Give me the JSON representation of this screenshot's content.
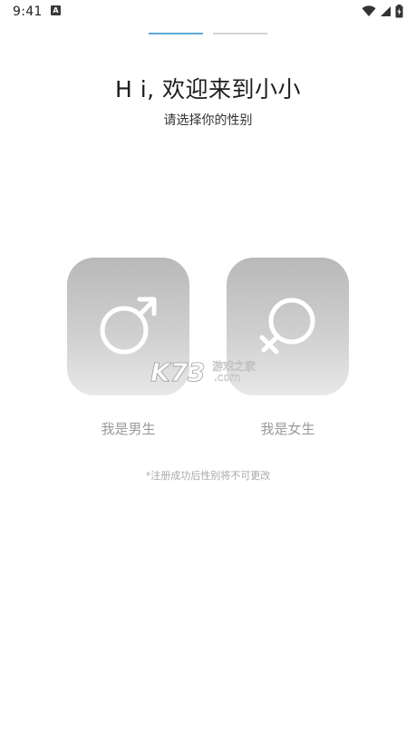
{
  "status_bar": {
    "time": "9:41",
    "notification_icon": "a-notification-icon",
    "wifi_icon": "wifi-icon",
    "signal_icon": "signal-icon",
    "battery_icon": "battery-charging-icon"
  },
  "progress": {
    "total_steps": 2,
    "current_step": 1,
    "active_color": "#5aa9d6",
    "inactive_color": "#d4d4d4"
  },
  "header": {
    "title": "H i, 欢迎来到小小",
    "subtitle": "请选择你的性别"
  },
  "gender_options": [
    {
      "id": "male",
      "icon": "male-symbol-icon",
      "label": "我是男生"
    },
    {
      "id": "female",
      "icon": "female-symbol-icon",
      "label": "我是女生"
    }
  ],
  "note": "*注册成功后性别将不可更改",
  "watermark": {
    "brand": "K73",
    "text": "游戏之家",
    "domain": ".com"
  }
}
